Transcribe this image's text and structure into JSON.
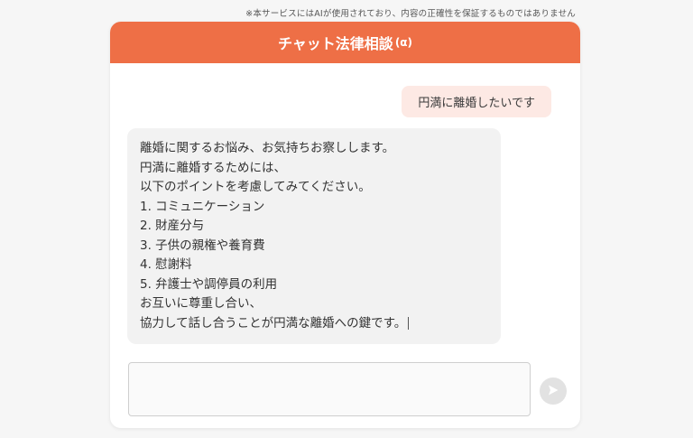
{
  "disclaimer": "※本サービスにはAIが使用されており、内容の正確性を保証するものではありません",
  "header": {
    "title": "チャット法律相談",
    "alpha": "(α)"
  },
  "colors": {
    "accent": "#ee6f46",
    "user_bubble": "#fde9e4",
    "bot_bubble": "#f2f2f2"
  },
  "messages": {
    "user": "円満に離婚したいです",
    "bot_lines": [
      "離婚に関するお悩み、お気持ちお察しします。",
      "円満に離婚するためには、",
      "以下のポイントを考慮してみてください。",
      "1. コミュニケーション",
      "2. 財産分与",
      "3. 子供の親権や養育費",
      "4. 慰謝料",
      "5. 弁護士や調停員の利用",
      "お互いに尊重し合い、",
      "協力して話し合うことが円満な離婚への鍵です。"
    ]
  },
  "composer": {
    "value": "",
    "send_icon": "send-arrow-icon"
  }
}
